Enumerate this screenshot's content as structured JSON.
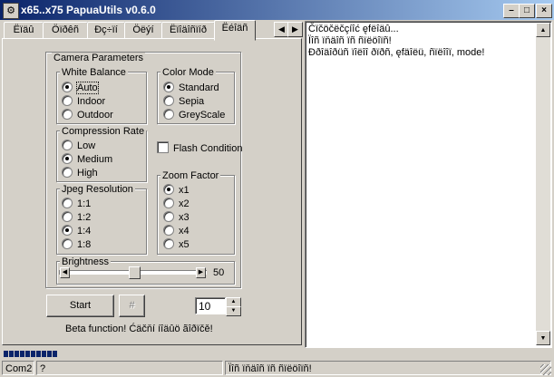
{
  "window": {
    "title": "x65..x75 PapuaUtils v0.6.0"
  },
  "tabs": [
    {
      "label": "Ёїäû",
      "active": false
    },
    {
      "label": "Öïðêñ",
      "active": false
    },
    {
      "label": "Ðç÷ïí",
      "active": false
    },
    {
      "label": "Öëýí",
      "active": false
    },
    {
      "label": "Ëïîäîñïíð",
      "active": false
    },
    {
      "label": "Ëéîäñ",
      "active": true
    }
  ],
  "camera": {
    "title": "Camera Parameters",
    "white_balance": {
      "label": "White Balance",
      "options": [
        "Auto",
        "Indoor",
        "Outdoor"
      ],
      "selected": "Auto"
    },
    "color_mode": {
      "label": "Color Mode",
      "options": [
        "Standard",
        "Sepia",
        "GreyScale"
      ],
      "selected": "Standard"
    },
    "compression": {
      "label": "Compression Rate",
      "options": [
        "Low",
        "Medium",
        "High"
      ],
      "selected": "Medium"
    },
    "flash": {
      "label": "Flash Condition",
      "checked": false
    },
    "resolution": {
      "label": "Jpeg Resolution",
      "options": [
        "1:1",
        "1:2",
        "1:4",
        "1:8"
      ],
      "selected": "1:4"
    },
    "zoom": {
      "label": "Zoom Factor",
      "options": [
        "x1",
        "x2",
        "x3",
        "x4",
        "x5"
      ],
      "selected": "x1"
    },
    "brightness": {
      "label": "Brightness",
      "value": "50"
    }
  },
  "controls": {
    "start_label": "Start",
    "hash_label": "#",
    "spin_value": "10",
    "beta_note": "Beta function! Ćäčňí íîäûö ãîðïčě!"
  },
  "log": [
    "Čïčöčëčçíîć  ęfëîäû...",
    "Ïîñ ïňäîñ ïñ ñïëöîïñ!",
    "Ððîäîðüñ ïîëîî ðïðñ, ęfäîëü, ñïëîîï, mode!"
  ],
  "status": {
    "port": "Com2",
    "help": "?",
    "message": "Ïîñ ïňäîñ ïñ ñïëöîïñ!"
  },
  "progress": {
    "segments": 10
  }
}
